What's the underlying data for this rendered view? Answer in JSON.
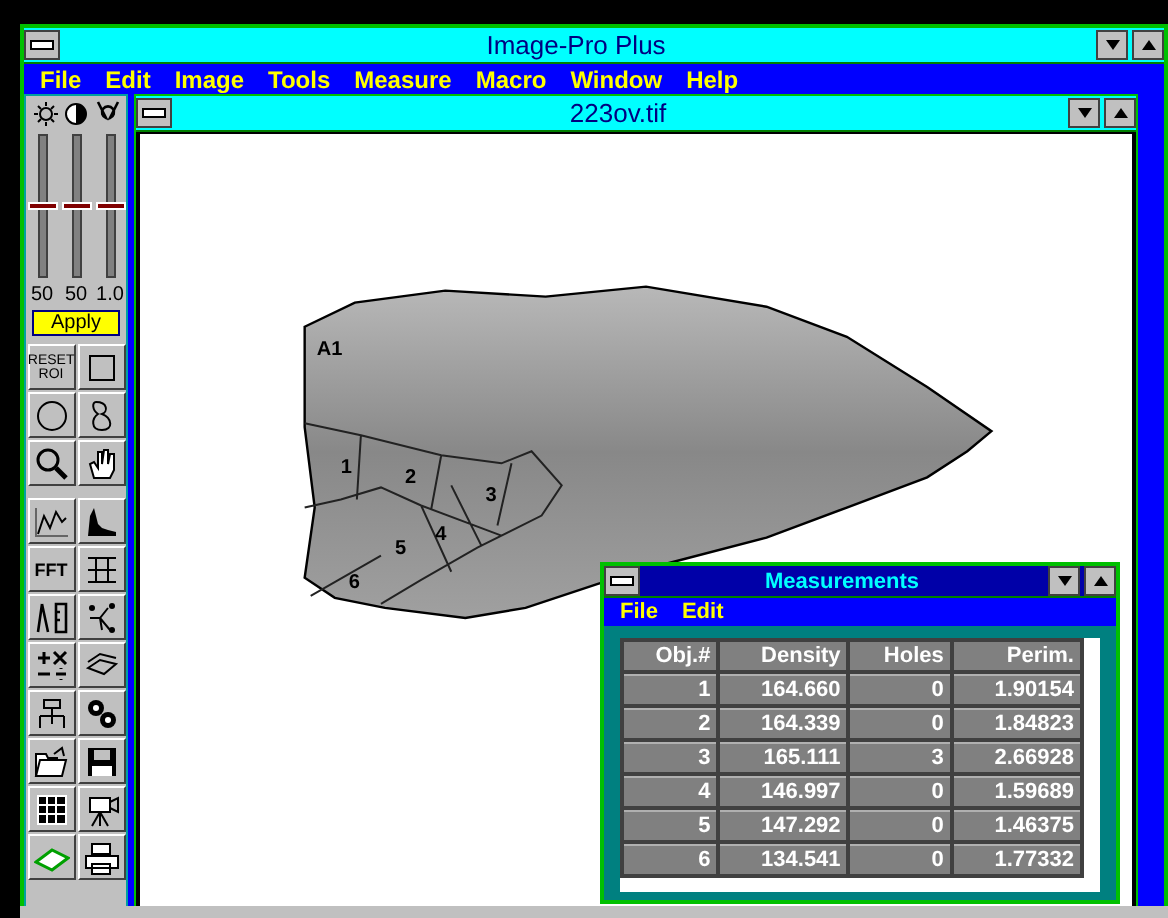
{
  "window": {
    "title": "Image-Pro Plus"
  },
  "menu": [
    "File",
    "Edit",
    "Image",
    "Tools",
    "Measure",
    "Macro",
    "Window",
    "Help"
  ],
  "toolbar": {
    "sliders": [
      {
        "level": 0.5,
        "reading": "50"
      },
      {
        "level": 0.5,
        "reading": "50"
      },
      {
        "level": 0.5,
        "reading": "1.0"
      }
    ],
    "apply_button": "Apply",
    "reset_button": "RESET ROI",
    "fft_button": "FFT"
  },
  "image_window": {
    "title": "223ov.tif",
    "region_labels": [
      "A1",
      "1",
      "2",
      "3",
      "4",
      "5",
      "6"
    ]
  },
  "measurements": {
    "title": "Measurements",
    "menu": [
      "File",
      "Edit"
    ],
    "columns": [
      "Obj.#",
      "Density",
      "Holes",
      "Perim."
    ],
    "rows": [
      [
        "1",
        "164.660",
        "0",
        "1.90154"
      ],
      [
        "2",
        "164.339",
        "0",
        "1.84823"
      ],
      [
        "3",
        "165.111",
        "3",
        "2.66928"
      ],
      [
        "4",
        "146.997",
        "0",
        "1.59689"
      ],
      [
        "5",
        "147.292",
        "0",
        "1.46375"
      ],
      [
        "6",
        "134.541",
        "0",
        "1.77332"
      ]
    ]
  }
}
